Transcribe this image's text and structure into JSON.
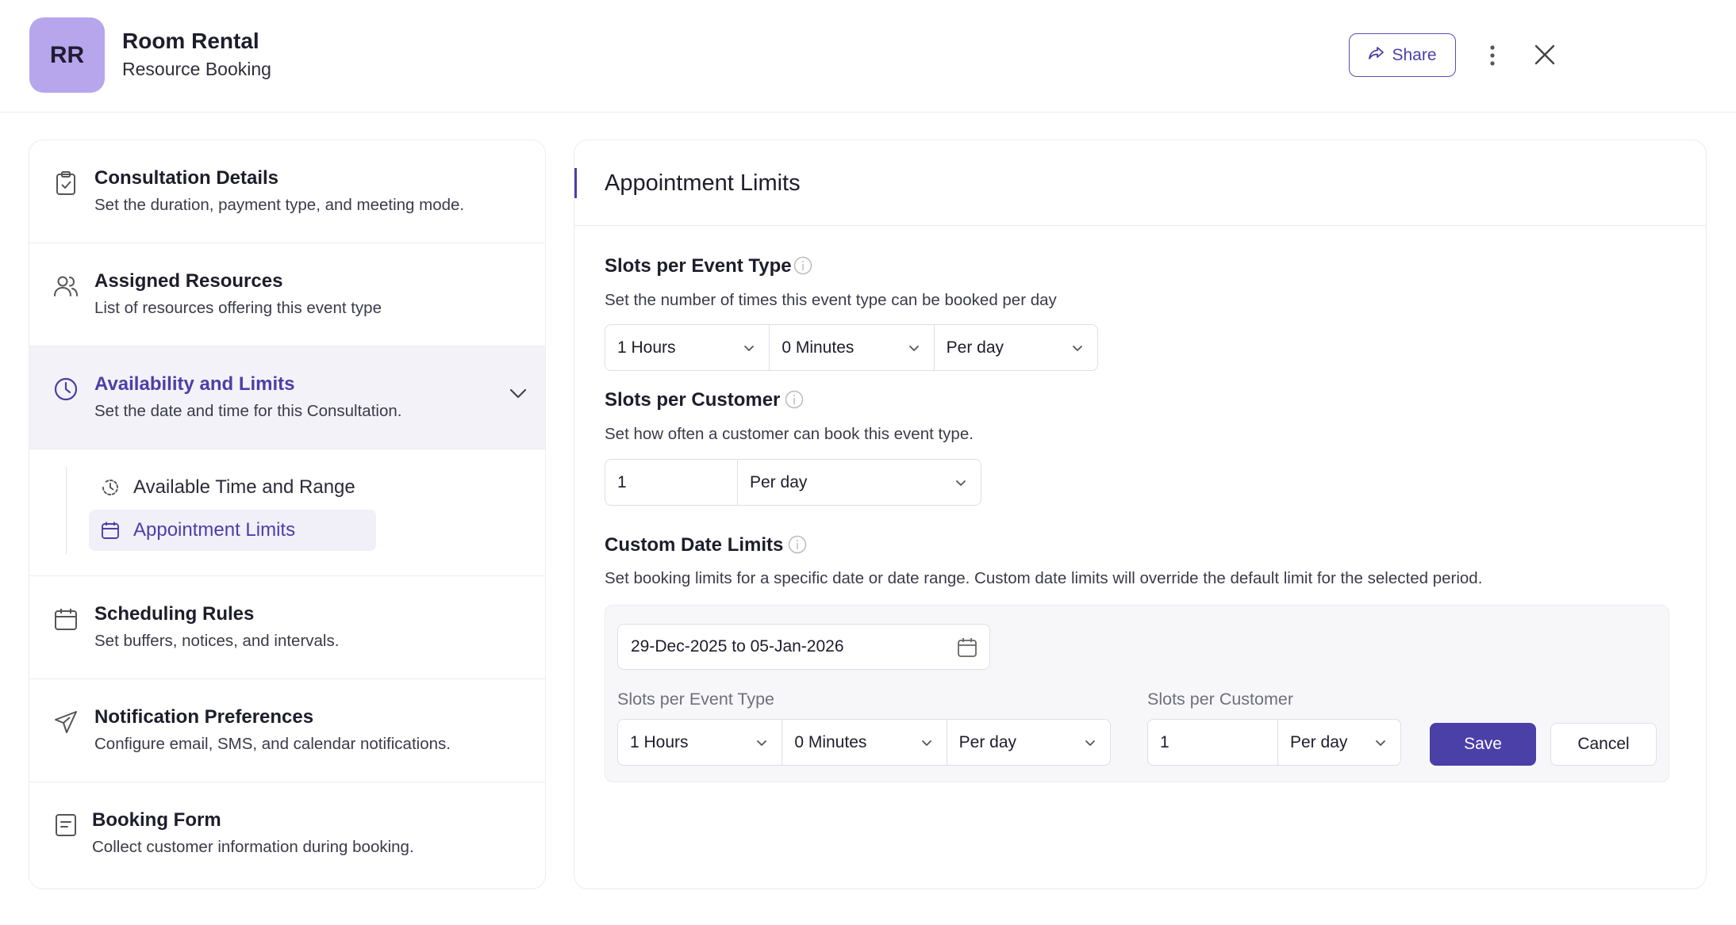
{
  "header": {
    "avatar_initials": "RR",
    "title": "Room Rental",
    "subtitle": "Resource Booking",
    "share_label": "Share",
    "icons": {
      "share": "share-arrow-icon",
      "more": "more-vertical-icon",
      "close": "close-icon"
    }
  },
  "sidebar": {
    "items": [
      {
        "title": "Consultation Details",
        "desc": "Set the duration, payment type, and meeting mode.",
        "icon": "clipboard-icon"
      },
      {
        "title": "Assigned Resources",
        "desc": "List of resources offering this event type",
        "icon": "users-icon"
      },
      {
        "title": "Availability and Limits",
        "desc": "Set the date and time for this Consultation.",
        "icon": "clock-icon",
        "active": true
      },
      {
        "title": "Scheduling Rules",
        "desc": "Set buffers, notices, and intervals.",
        "icon": "calendar-icon"
      },
      {
        "title": "Notification Preferences",
        "desc": "Configure email, SMS, and calendar notifications.",
        "icon": "send-icon"
      },
      {
        "title": "Booking Form",
        "desc": "Collect customer information during booking.",
        "icon": "form-icon"
      }
    ],
    "subitems": [
      {
        "label": "Available Time and Range",
        "icon": "clock-rotate-icon"
      },
      {
        "label": "Appointment Limits",
        "icon": "calendar-icon",
        "selected": true
      }
    ]
  },
  "main": {
    "title": "Appointment Limits",
    "slots_event": {
      "title": "Slots per Event Type",
      "desc": "Set the number of times this event type can be booked per day",
      "hours": "1 Hours",
      "minutes": "0 Minutes",
      "period": "Per day"
    },
    "slots_customer": {
      "title": "Slots per Customer",
      "desc": "Set how often a customer can book this event type.",
      "count": "1",
      "period": "Per day"
    },
    "custom": {
      "title": "Custom Date Limits",
      "desc": "Set booking limits for a specific date or date range. Custom date limits will override the default limit for the selected period.",
      "date_range": "29-Dec-2025 to 05-Jan-2026",
      "event_label": "Slots per Event Type",
      "hours": "1 Hours",
      "minutes": "0 Minutes",
      "event_period": "Per day",
      "customer_label": "Slots per Customer",
      "customer_count": "1",
      "customer_period": "Per day",
      "save_label": "Save",
      "cancel_label": "Cancel"
    }
  },
  "colors": {
    "accent": "#4b3fa8",
    "avatar_bg": "#b7a6ec",
    "active_bg": "#f3f2f8"
  }
}
